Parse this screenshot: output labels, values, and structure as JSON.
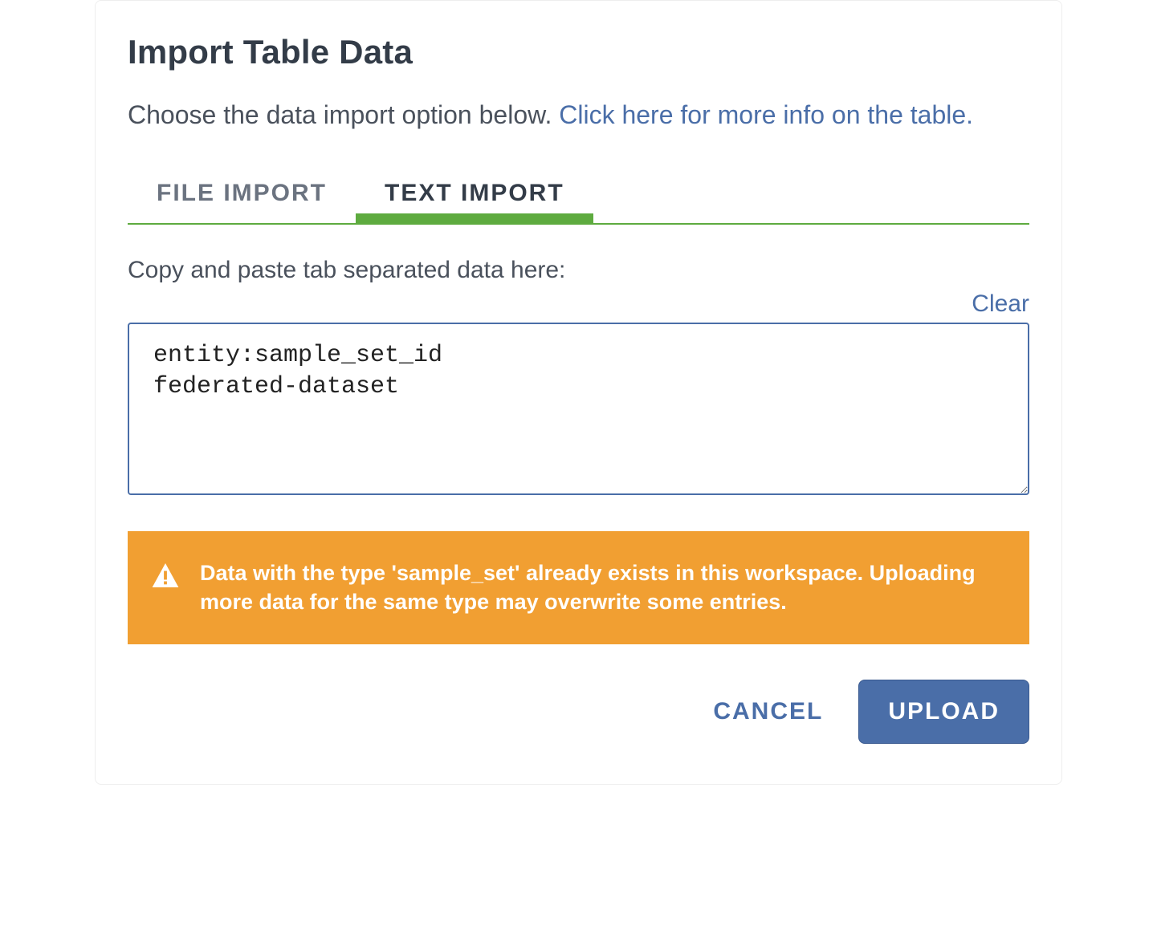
{
  "title": "Import Table Data",
  "subtitle": {
    "lead": "Choose the data import option below. ",
    "link": "Click here for more info on the table."
  },
  "tabs": {
    "file": "FILE IMPORT",
    "text": "TEXT IMPORT",
    "active": "text"
  },
  "textImport": {
    "label": "Copy and paste tab separated data here:",
    "clear": "Clear",
    "value": "entity:sample_set_id\nfederated-dataset"
  },
  "warning": "Data with the type 'sample_set' already exists in this workspace. Uploading more data for the same type may overwrite some entries.",
  "actions": {
    "cancel": "CANCEL",
    "upload": "UPLOAD"
  },
  "colors": {
    "accentGreen": "#5eab3f",
    "accentBlue": "#4a6ea8",
    "warningOrange": "#f19f32"
  }
}
